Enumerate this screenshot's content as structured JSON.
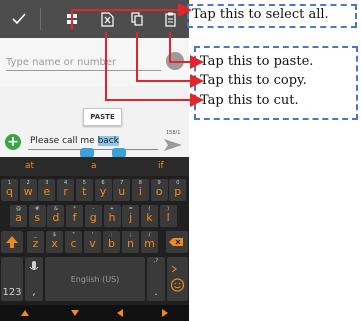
{
  "app": {
    "recipient_placeholder": "Type name or number",
    "paste_tooltip": "PASTE",
    "message_before": "Please call me ",
    "message_selected": "back",
    "char_count": "158/1"
  },
  "keyboard": {
    "suggestions": [
      "at",
      "a",
      "if"
    ],
    "row1": [
      {
        "main": "q",
        "alt": "1"
      },
      {
        "main": "w",
        "alt": "2"
      },
      {
        "main": "e",
        "alt": "3"
      },
      {
        "main": "r",
        "alt": "4"
      },
      {
        "main": "t",
        "alt": "5"
      },
      {
        "main": "y",
        "alt": "6"
      },
      {
        "main": "u",
        "alt": "7"
      },
      {
        "main": "i",
        "alt": "8"
      },
      {
        "main": "o",
        "alt": "9"
      },
      {
        "main": "p",
        "alt": "0"
      }
    ],
    "row2": [
      {
        "main": "a",
        "alt": "@"
      },
      {
        "main": "s",
        "alt": "#"
      },
      {
        "main": "d",
        "alt": "&"
      },
      {
        "main": "f",
        "alt": "*"
      },
      {
        "main": "g",
        "alt": "-"
      },
      {
        "main": "h",
        "alt": "+"
      },
      {
        "main": "j",
        "alt": "="
      },
      {
        "main": "k",
        "alt": "("
      },
      {
        "main": "l",
        "alt": ")"
      }
    ],
    "row3": [
      {
        "main": "z",
        "alt": "_"
      },
      {
        "main": "x",
        "alt": "$"
      },
      {
        "main": "c",
        "alt": "\""
      },
      {
        "main": "v",
        "alt": "'"
      },
      {
        "main": "b",
        "alt": ":"
      },
      {
        "main": "n",
        "alt": ";"
      },
      {
        "main": "m",
        "alt": "/"
      }
    ],
    "numbers_label": "123",
    "comma_label": ",",
    "space_label": "English (US)",
    "period_label": ".",
    "period_alt": ",?"
  },
  "callouts": {
    "select_all": "Tap this to select all.",
    "paste": "Tap this to paste.",
    "copy": "Tap this to copy.",
    "cut": "Tap this to cut."
  },
  "colors": {
    "accent_orange": "#f08a1e",
    "callout_arrow": "#e0262b",
    "callout_border": "#4a78c6",
    "selection_handle": "#3e9fd8"
  },
  "icons": {
    "done": "check-icon",
    "select_all": "select-all-icon",
    "cut": "cut-icon",
    "copy": "copy-icon",
    "paste": "paste-icon",
    "add": "add-icon",
    "send": "send-icon",
    "contact": "contact-icon",
    "shift": "shift-icon",
    "backspace": "backspace-icon",
    "microphone": "microphone-icon",
    "smiley": "smiley-icon"
  }
}
